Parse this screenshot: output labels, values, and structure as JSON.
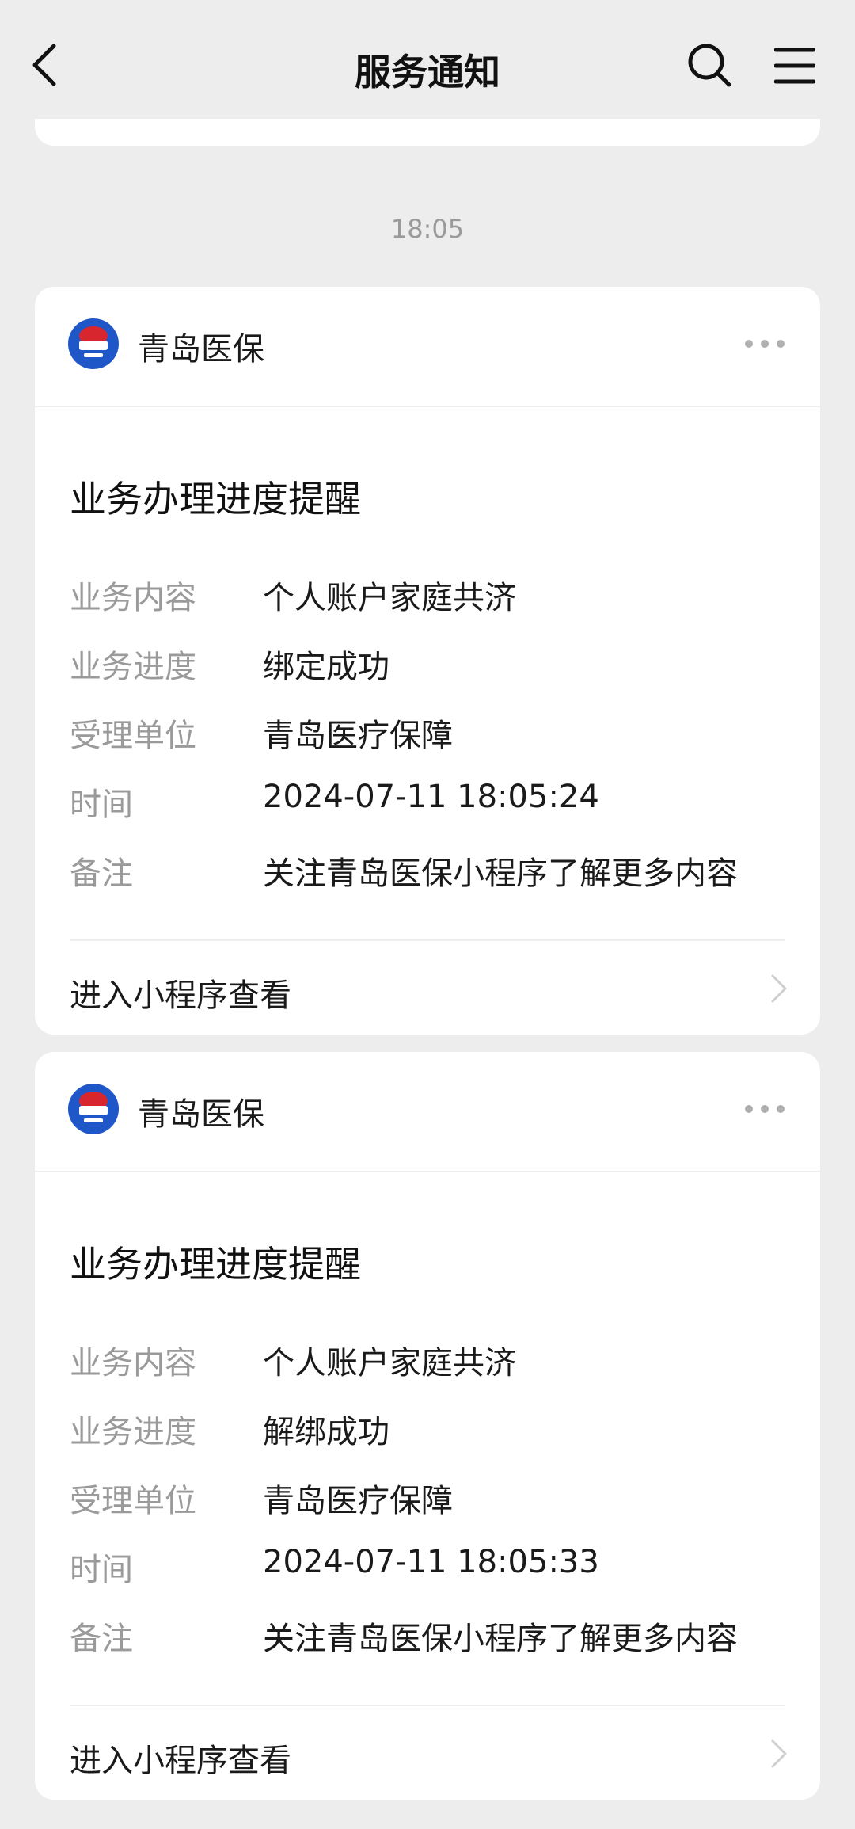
{
  "navbar": {
    "title": "服务通知",
    "back_icon": "back-arrow-icon",
    "search_icon": "search-icon",
    "menu_icon": "menu-icon"
  },
  "timestamp": "18:05",
  "cards": [
    {
      "sender": "青岛医保",
      "title": "业务办理进度提醒",
      "rows": [
        {
          "label": "业务内容",
          "value": "个人账户家庭共济"
        },
        {
          "label": "业务进度",
          "value": "绑定成功"
        },
        {
          "label": "受理单位",
          "value": "青岛医疗保障"
        },
        {
          "label": "时间",
          "value": "2024-07-11 18:05:24"
        },
        {
          "label": "备注",
          "value": "关注青岛医保小程序了解更多内容"
        }
      ],
      "link": "进入小程序查看"
    },
    {
      "sender": "青岛医保",
      "title": "业务办理进度提醒",
      "rows": [
        {
          "label": "业务内容",
          "value": "个人账户家庭共济"
        },
        {
          "label": "业务进度",
          "value": "解绑成功"
        },
        {
          "label": "受理单位",
          "value": "青岛医疗保障"
        },
        {
          "label": "时间",
          "value": "2024-07-11 18:05:33"
        },
        {
          "label": "备注",
          "value": "关注青岛医保小程序了解更多内容"
        }
      ],
      "link": "进入小程序查看"
    }
  ],
  "colors": {
    "background": "#ededed",
    "card": "#ffffff",
    "label_gray": "#9a9a9a",
    "text": "#1a1a1a",
    "avatar_blue": "#1f56c8",
    "avatar_red": "#d8262e"
  }
}
